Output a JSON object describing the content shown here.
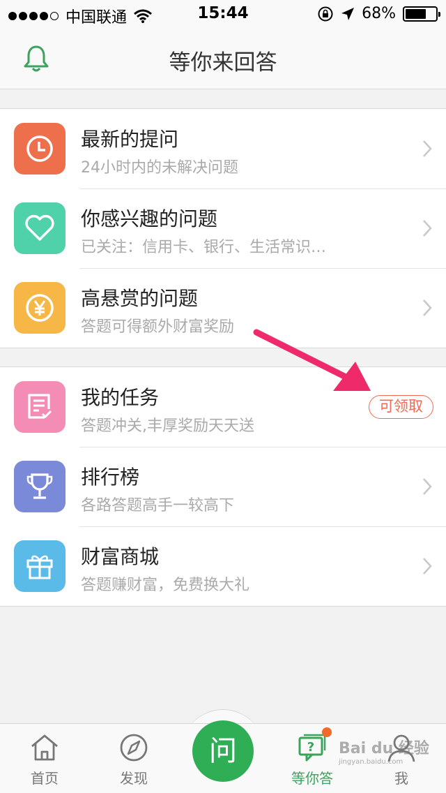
{
  "status": {
    "carrier": "中国联通",
    "time": "15:44",
    "battery": "68%",
    "battery_level": 0.68
  },
  "nav": {
    "title": "等你来回答"
  },
  "section1": [
    {
      "title": "最新的提问",
      "sub": "24小时内的未解决问题",
      "icon": "clock-icon",
      "color": "#ee6f4c"
    },
    {
      "title": "你感兴趣的问题",
      "sub": "已关注：信用卡、银行、生活常识…",
      "icon": "heart-icon",
      "color": "#4fd1aa"
    },
    {
      "title": "高悬赏的问题",
      "sub": "答题可得额外财富奖励",
      "icon": "yen-icon",
      "color": "#f6b746"
    }
  ],
  "section2": [
    {
      "title": "我的任务",
      "sub": "答题冲关,丰厚奖励天天送",
      "icon": "task-icon",
      "color": "#f48db5",
      "badge": "可领取"
    },
    {
      "title": "排行榜",
      "sub": "各路答题高手一较高下",
      "icon": "trophy-icon",
      "color": "#7b8ad8"
    },
    {
      "title": "财富商城",
      "sub": "答题赚财富，免费换大礼",
      "icon": "gift-icon",
      "color": "#5bbbe8"
    }
  ],
  "tabbar": {
    "home": "首页",
    "discover": "发现",
    "ask": "问",
    "answer": "等你答",
    "me": "我"
  },
  "watermark": {
    "main": "Bai du 经验",
    "sub": "jingyan.baidu.com"
  },
  "colors": {
    "accent": "#2fae55",
    "badge": "#f06a55",
    "arrow": "#ee2a6a"
  }
}
